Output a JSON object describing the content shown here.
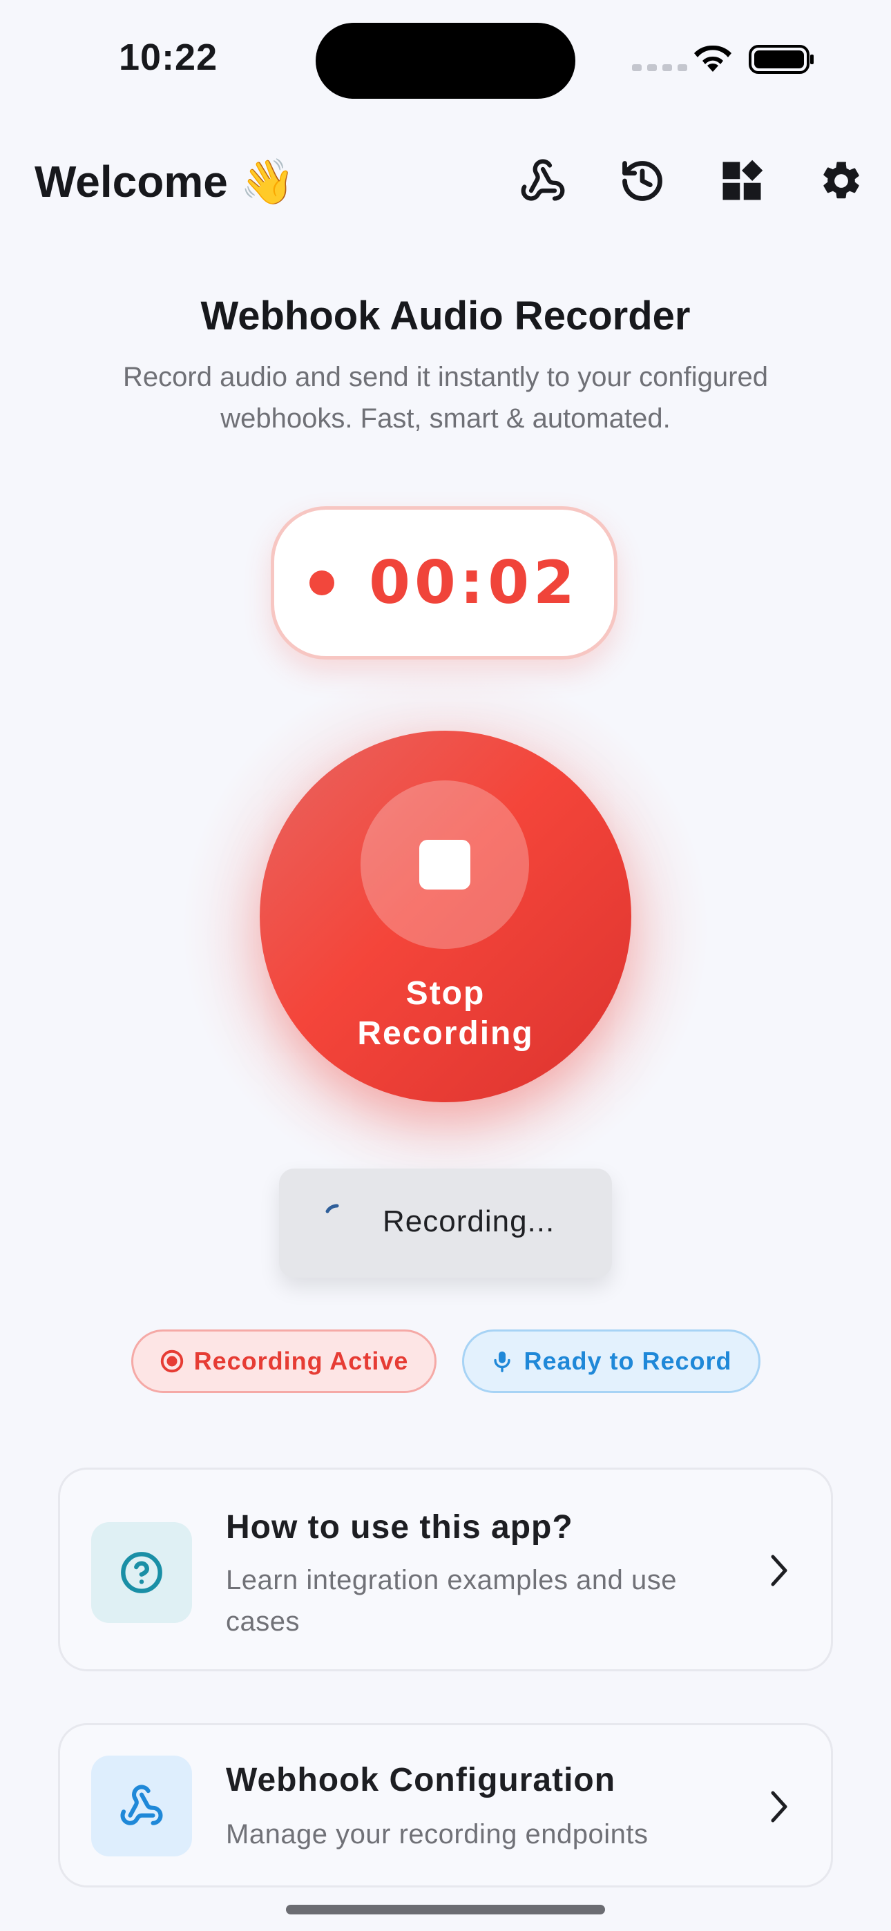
{
  "status_bar": {
    "time": "10:22"
  },
  "header": {
    "welcome": "Welcome 👋",
    "icons": [
      "webhook-icon",
      "history-icon",
      "widgets-icon",
      "gear-icon"
    ]
  },
  "intro": {
    "title": "Webhook Audio Recorder",
    "description": "Record audio and send it instantly to your configured webhooks. Fast, smart & automated."
  },
  "timer": {
    "value": "00:02"
  },
  "record_button": {
    "label": "Stop\nRecording"
  },
  "status_chip": {
    "text": "Recording..."
  },
  "badges": {
    "recording_active": "Recording Active",
    "ready_to_record": "Ready to Record"
  },
  "cards": [
    {
      "title": "How to use this app?",
      "subtitle": "Learn integration examples and use cases",
      "icon": "help-circle-icon"
    },
    {
      "title": "Webhook Configuration",
      "subtitle": "Manage your recording endpoints",
      "icon": "webhook-icon"
    }
  ],
  "colors": {
    "accent_red": "#f2473c",
    "accent_blue": "#1f88d8",
    "teal": "#1a8fa6",
    "background": "#f6f7fc"
  }
}
